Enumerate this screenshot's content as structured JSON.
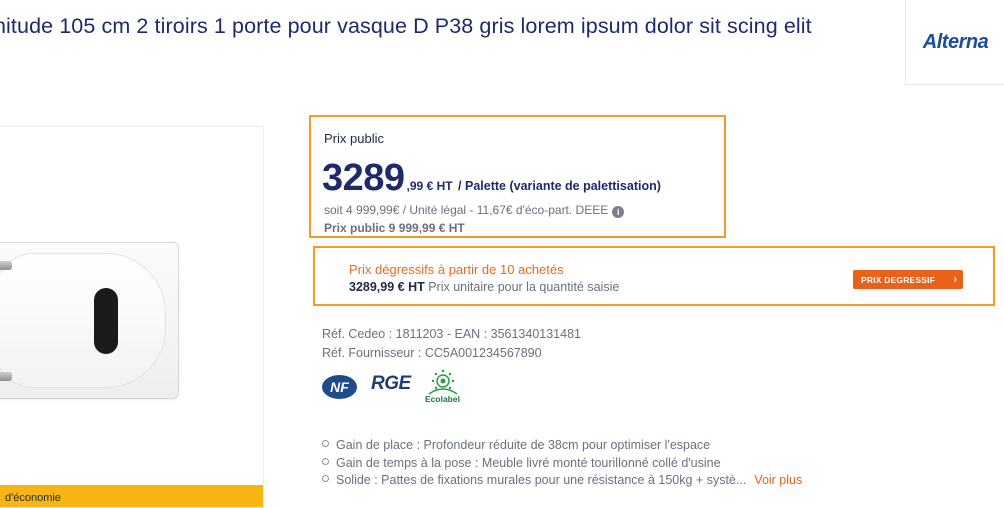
{
  "product": {
    "title": "nitude 105 cm 2 tiroirs 1 porte pour vasque D P38 gris lorem ipsum dolor sit scing elit"
  },
  "brand": {
    "logo_text": "Alterna"
  },
  "image_panel": {
    "eco_badge": "d'économie"
  },
  "price": {
    "label": "Prix public",
    "integer": "3289",
    "decimals": ",99 € HT",
    "unit": " / Palette (variante de palettisation)",
    "soit": "soit 4 999,99€ / Unité légal - 11,67€ d'éco-part. DEEE",
    "info_icon": "i",
    "public_price": "Prix public 9 999,99 € HT"
  },
  "degressive": {
    "title": "Prix dégressifs à partir de 10 achetés",
    "price": "3289,99 € HT",
    "description": " Prix unitaire pour la quantité saisie",
    "button_label": "PRIX DEGRESSIF",
    "button_icon": "›"
  },
  "refs": {
    "cedeo": "Réf. Cedeo : 1811203 - EAN : 3561340131481",
    "supplier": "Réf. Fournisseur : CC5A001234567890"
  },
  "certifications": {
    "nf": "NF",
    "rge": "RGE",
    "ecolabel": "Ecolabel"
  },
  "features": [
    "Gain de place : Profondeur réduite de 38cm pour optimiser l'espace",
    "Gain de temps à la pose : Meuble livré monté tourillonné collé d'usine",
    "Solide : Pattes de fixations murales pour une résistance à 150kg + systè..."
  ],
  "see_more": "Voir plus",
  "colors": {
    "accent": "#e8621a",
    "highlight_border": "#f39a2b",
    "title": "#1f2a6b",
    "muted": "#6b7080"
  }
}
